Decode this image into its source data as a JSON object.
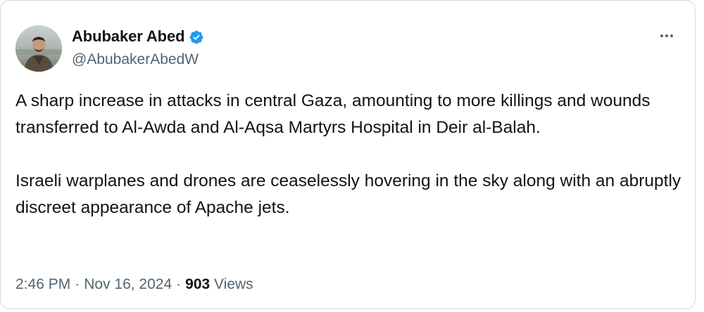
{
  "author": {
    "display_name": "Abubaker Abed",
    "handle": "@AbubakerAbedW",
    "verified": true,
    "verified_color": "#1d9bf0"
  },
  "tweet": {
    "paragraphs": [
      "A sharp increase in attacks in central Gaza, amounting to more killings and wounds transferred to Al-Awda and Al-Aqsa Martyrs Hospital in Deir al-Balah.",
      "Israeli warplanes and drones are ceaselessly hovering in the sky along with an abruptly discreet appearance of Apache jets."
    ]
  },
  "meta": {
    "time": "2:46 PM",
    "date": "Nov 16, 2024",
    "separator": "·",
    "views_count": "903",
    "views_label": "Views"
  },
  "icons": {
    "more": "more-horizontal-icon",
    "verified": "verified-badge-icon",
    "avatar": "profile-photo"
  }
}
